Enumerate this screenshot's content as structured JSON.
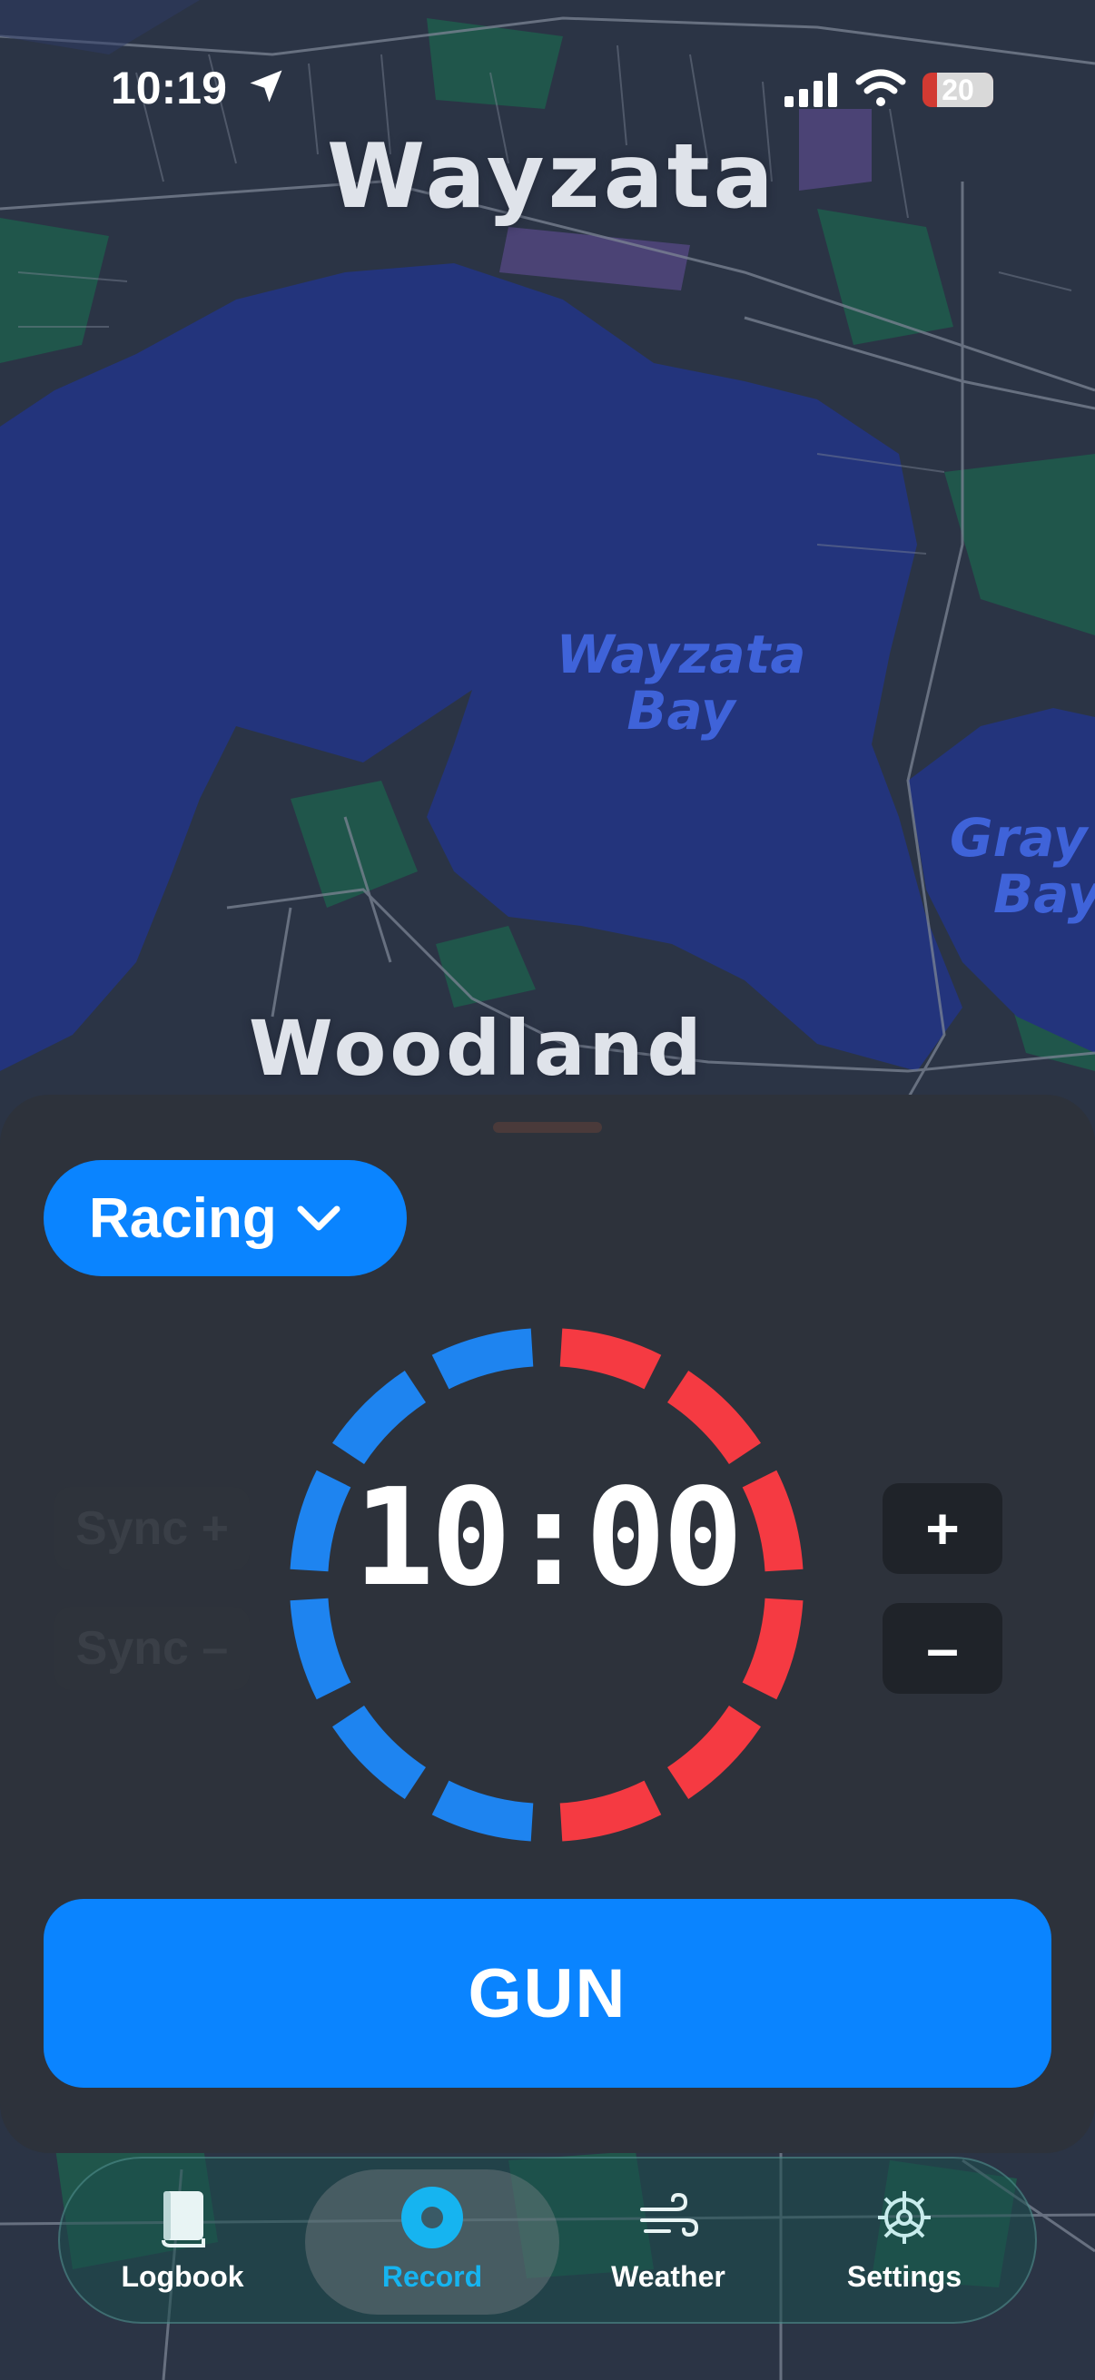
{
  "status_bar": {
    "time": "10:19",
    "battery": "20",
    "battery_fraction": 0.2
  },
  "map": {
    "labels": {
      "town_north": "Wayzata",
      "town_south": "Woodland",
      "bay_main_line1": "Wayzata",
      "bay_main_line2": "Bay",
      "bay_east_line1": "Gray",
      "bay_east_line2": "Bay"
    },
    "colors": {
      "water": "#23347c",
      "land": "#2b3445",
      "park": "#1f5a4b"
    }
  },
  "panel": {
    "mode_selector": {
      "label": "Racing",
      "icon": "chevron-down-icon"
    },
    "sync_plus": "Sync +",
    "sync_minus": "Sync –",
    "timer": {
      "display": "10:00",
      "segments_total": 12,
      "segments_red": 6,
      "segments_blue": 6
    },
    "increment": "+",
    "decrement": "–",
    "gun_label": "GUN"
  },
  "tabs": [
    {
      "label": "Logbook",
      "icon": "book-icon",
      "active": false
    },
    {
      "label": "Record",
      "icon": "record-icon",
      "active": true
    },
    {
      "label": "Weather",
      "icon": "wind-icon",
      "active": false
    },
    {
      "label": "Settings",
      "icon": "gear-icon",
      "active": false
    }
  ],
  "colors": {
    "accent": "#0a84ff",
    "countdown_red": "#f53a42",
    "countdown_blue": "#1e84f0",
    "active_tab": "#16b4f0",
    "panel": "#2d323b"
  }
}
